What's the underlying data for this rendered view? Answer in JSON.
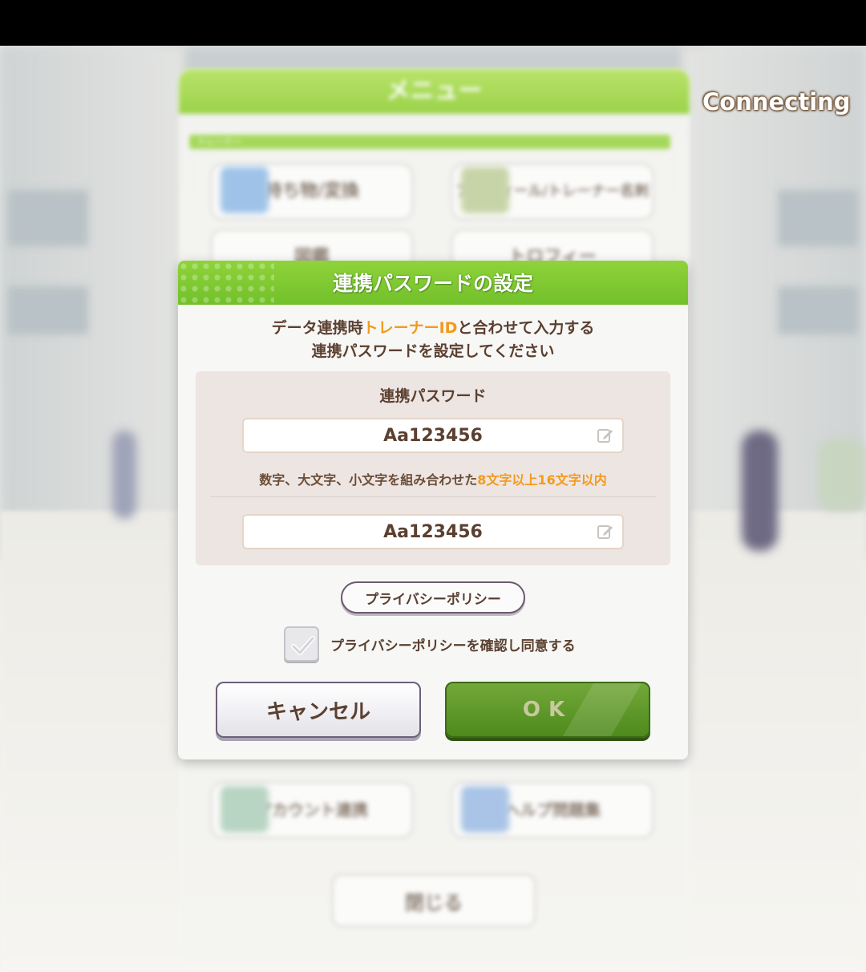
{
  "status": {
    "connecting_label": "Connecting"
  },
  "background_menu": {
    "title": "メニュー",
    "section_label": "トレーナー",
    "items": [
      {
        "label": "持ち物/変換"
      },
      {
        "label": "プロフィール/トレーナー名刺"
      },
      {
        "label": "図鑑"
      },
      {
        "label": "トロフィー"
      },
      {
        "label": "アカウント連携"
      },
      {
        "label": "ヘルプ問題集"
      }
    ],
    "close_label": "閉じる"
  },
  "dialog": {
    "title": "連携パスワードの設定",
    "description": {
      "line1_prefix": "データ連携時",
      "line1_highlight": "トレーナーID",
      "line1_suffix": "と合わせて入力する",
      "line2": "連携パスワードを設定してください"
    },
    "password": {
      "label": "連携パスワード",
      "value": "Aa123456",
      "confirm_value": "Aa123456",
      "hint_prefix": "数字、大文字、小文字を組み合わせた",
      "hint_highlight": "8文字以上16文字以内"
    },
    "privacy_policy_button": "プライバシーポリシー",
    "agree_checkbox": {
      "label": "プライバシーポリシーを確認し同意する",
      "checked": false
    },
    "cancel_label": "キャンセル",
    "ok_label": "OK"
  },
  "colors": {
    "header_green": "#7fca30",
    "text_brown": "#5b4030",
    "highlight_orange": "#f39a1c",
    "ok_green": "#5a951f"
  }
}
